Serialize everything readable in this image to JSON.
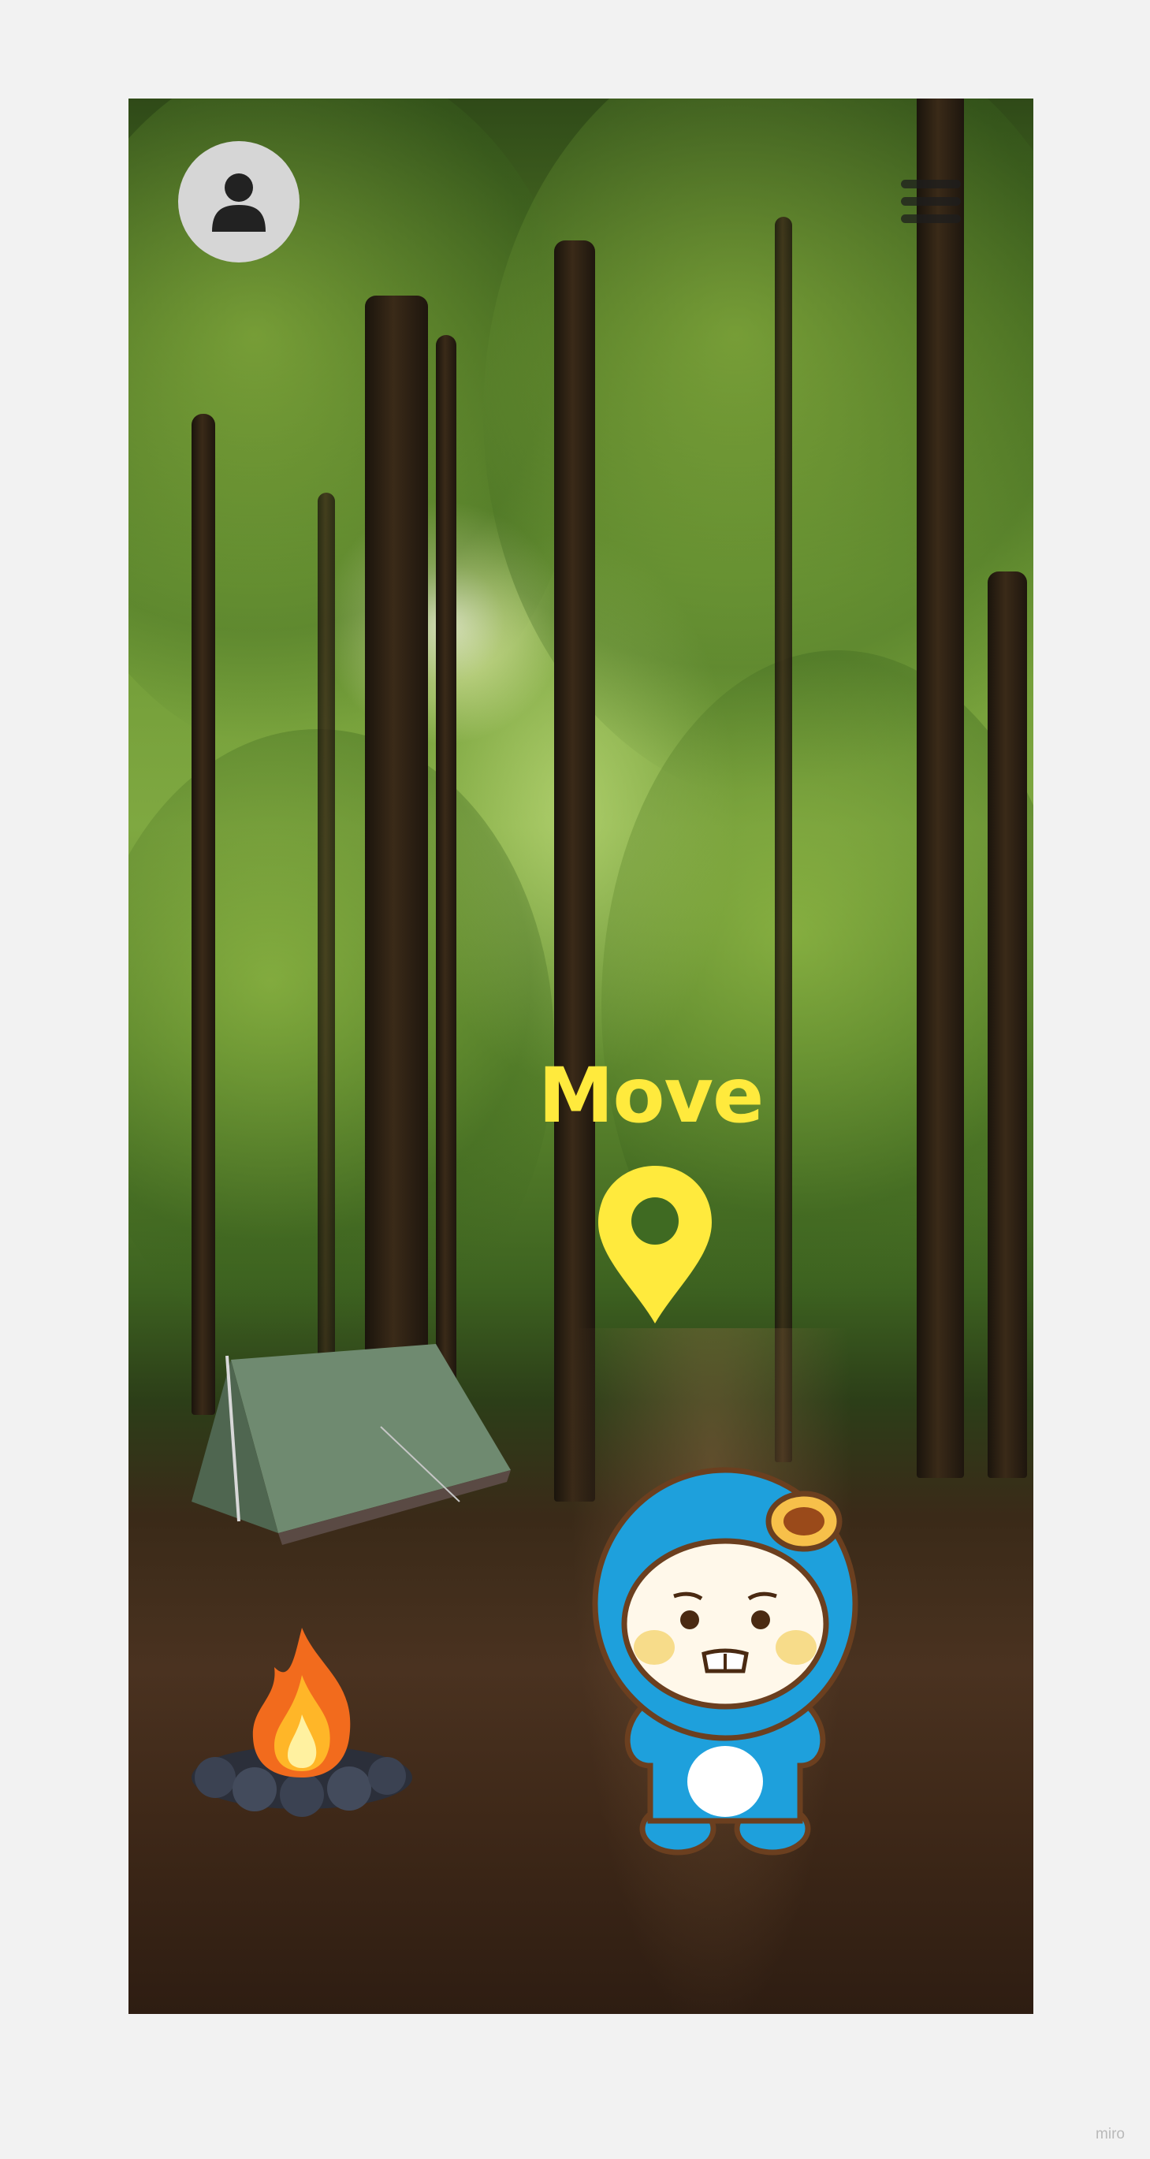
{
  "scene": {
    "background": "forest-clearing-illustration",
    "accent_color": "#ffea3d"
  },
  "header": {
    "profile_icon": "user-avatar-icon",
    "menu_icon": "hamburger-menu-icon"
  },
  "actions": {
    "move_label": "Move",
    "move_icon": "map-pin-icon"
  },
  "objects": {
    "tent": "tent-icon",
    "campfire": "campfire-icon",
    "character": "blue-mascot-character"
  },
  "footer": {
    "watermark": "miro"
  }
}
